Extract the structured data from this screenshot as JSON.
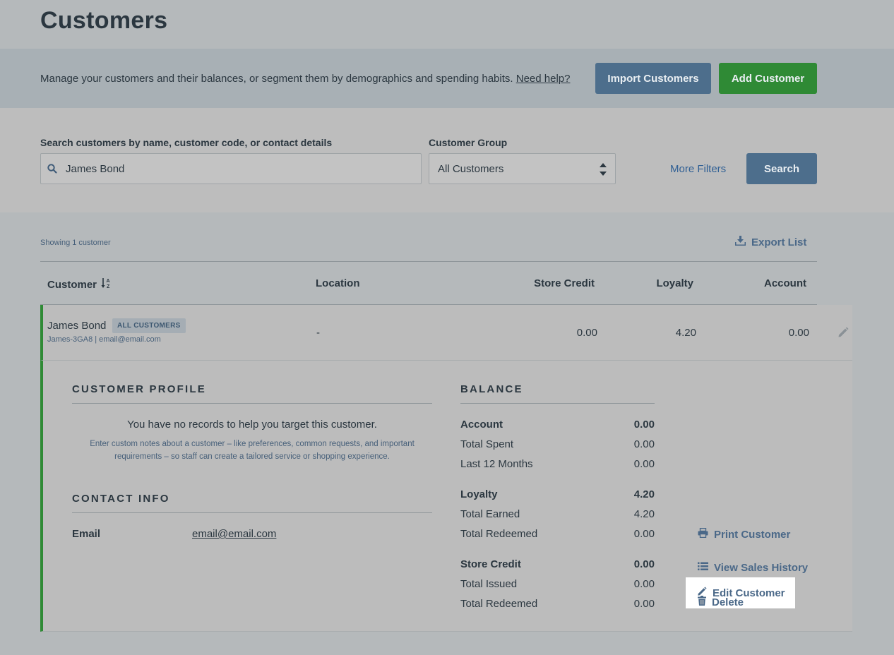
{
  "page": {
    "title": "Customers"
  },
  "intro": {
    "text": "Manage your customers and their balances, or segment them by demographics and spending habits.",
    "help_link": "Need help?",
    "import_button": "Import Customers",
    "add_button": "Add Customer"
  },
  "search": {
    "label": "Search customers by name, customer code, or contact details",
    "value": "James Bond",
    "group_label": "Customer Group",
    "group_value": "All Customers",
    "more_filters": "More Filters",
    "search_button": "Search"
  },
  "list": {
    "showing": "Showing 1 customer",
    "export": "Export List",
    "columns": {
      "customer": "Customer",
      "location": "Location",
      "store_credit": "Store Credit",
      "loyalty": "Loyalty",
      "account": "Account"
    },
    "row": {
      "name": "James Bond",
      "badge": "ALL CUSTOMERS",
      "sub": "James-3GA8 | email@email.com",
      "location": "-",
      "store_credit": "0.00",
      "loyalty": "4.20",
      "account": "0.00"
    }
  },
  "detail": {
    "profile_heading": "CUSTOMER PROFILE",
    "no_records": "You have no records to help you target this customer.",
    "notes": "Enter custom notes about a customer – like preferences, common requests, and important requirements – so staff can create a tailored service or shopping experience.",
    "contact_heading": "CONTACT INFO",
    "email_label": "Email",
    "email_value": "email@email.com",
    "balance_heading": "BALANCE",
    "balance": [
      {
        "label": "Account",
        "value": "0.00",
        "bold": true
      },
      {
        "label": "Total Spent",
        "value": "0.00"
      },
      {
        "label": "Last 12 Months",
        "value": "0.00"
      },
      {
        "label": "Loyalty",
        "value": "4.20",
        "bold": true
      },
      {
        "label": "Total Earned",
        "value": "4.20"
      },
      {
        "label": "Total Redeemed",
        "value": "0.00"
      },
      {
        "label": "Store Credit",
        "value": "0.00",
        "bold": true
      },
      {
        "label": "Total Issued",
        "value": "0.00"
      },
      {
        "label": "Total Redeemed",
        "value": "0.00"
      }
    ],
    "edit_customer": "Edit Customer",
    "print_customer": "Print Customer",
    "view_sales_history": "View Sales History",
    "delete": "Delete"
  },
  "colors": {
    "accent": "#4d6e8c",
    "success": "#2f8a35",
    "link": "#2f5f94"
  }
}
